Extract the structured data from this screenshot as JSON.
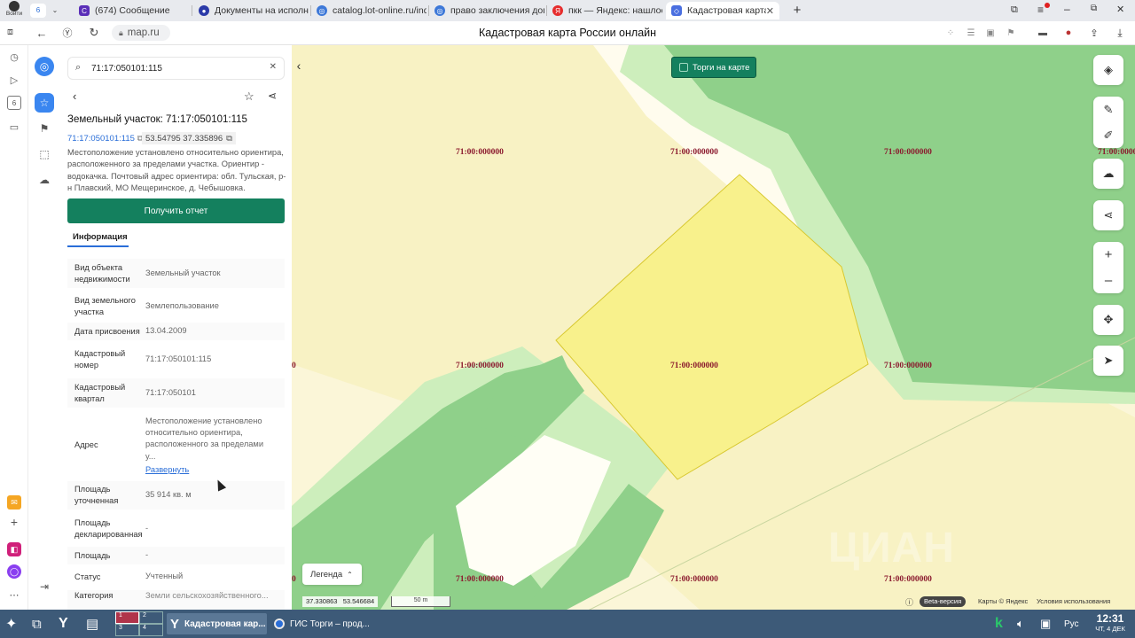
{
  "browser": {
    "tab_count": "6",
    "tabs": [
      {
        "title": "(674) Сообщение",
        "icon": "mail-tab-icon",
        "color": "#5b2fb8"
      },
      {
        "title": "Документы на исполнен",
        "icon": "doc-tab-icon",
        "color": "#2b3aa8"
      },
      {
        "title": "catalog.lot-online.ru/inde",
        "icon": "globe-tab-icon",
        "color": "#3d78d8"
      },
      {
        "title": "право заключения догов",
        "icon": "globe-tab-icon",
        "color": "#3d78d8"
      },
      {
        "title": "пкк — Яндекс: нашлось",
        "icon": "yandex-tab-icon",
        "color": "#e62d2d"
      },
      {
        "title": "Кадастровая карта Ро",
        "icon": "map-tab-icon",
        "color": "#4a6fe0"
      }
    ],
    "profile_label": "Войти",
    "url": "map.ru",
    "page_title": "Кадастровая карта России онлайн",
    "sidebar_badge": "6"
  },
  "panel": {
    "search_value": "71:17:050101:115",
    "title": "Земельный участок: 71:17:050101:115",
    "cad_link": "71:17:050101:115",
    "coords": "53.54795 37.335896",
    "description": "Местоположение установлено относительно ориентира, расположенного за пределами участка. Ориентир - водокачка. Почтовый адрес ориентира: обл. Тульская, р-н Плавский, МО Мещеринское, д. Чебышовка.",
    "report_button": "Получить отчет",
    "tab_info": "Информация",
    "expand_link": "Развернуть",
    "rows": [
      {
        "key": "Вид объекта недвижимости",
        "value": "Земельный участок"
      },
      {
        "key": "Вид земельного участка",
        "value": "Землепользование"
      },
      {
        "key": "Дата присвоения",
        "value": "13.04.2009"
      },
      {
        "key": "Кадастровый номер",
        "value": "71:17:050101:115"
      },
      {
        "key": "Кадастровый квартал",
        "value": "71:17:050101"
      },
      {
        "key": "Адрес",
        "value": "Местоположение установлено относительно ориентира, расположенного за пределами у..."
      },
      {
        "key": "Площадь уточненная",
        "value": "35 914 кв. м"
      },
      {
        "key": "Площадь декларированная",
        "value": "-"
      },
      {
        "key": "Площадь",
        "value": "-"
      },
      {
        "key": "Статус",
        "value": "Учтенный"
      },
      {
        "key": "Категория",
        "value": "Земли сельскохозяйственного..."
      }
    ]
  },
  "map": {
    "torgi_toggle": "Торги на карте",
    "cadastral_label": "71:00:000000",
    "legend_button": "Легенда",
    "coords_readout": "37.330863   53.546684",
    "scale_label": "50 m",
    "beta_label": "Beta-версия",
    "attribution": "Карты © Яндекс",
    "terms": "Условия использования",
    "watermark": "ЦИАН",
    "colors": {
      "parcel_yellow": "#f8f18c",
      "forest_green": "#8fd08a",
      "light_green": "#cdeebc",
      "cream": "#fbf6d8"
    }
  },
  "taskbar": {
    "active_window": "Кадастровая кар...",
    "second_window": "ГИС Торги – прод...",
    "desktops": [
      "1",
      "2",
      "3",
      "4"
    ],
    "lang": "Рус",
    "time": "12:31",
    "date": "ЧТ, 4 ДЕК"
  }
}
